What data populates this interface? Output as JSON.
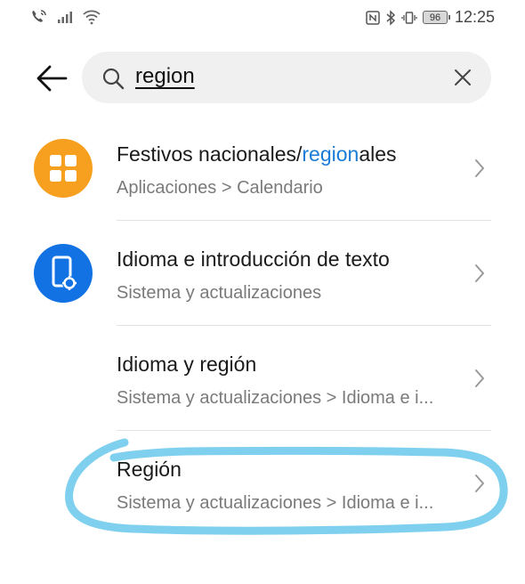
{
  "status_bar": {
    "battery": "96",
    "time": "12:25"
  },
  "search": {
    "query": "region"
  },
  "results": [
    {
      "title_parts": [
        "Festivos nacionales/",
        "region",
        "ales"
      ],
      "subtitle": "Aplicaciones > Calendario",
      "icon": "calendar-app-icon",
      "icon_color": "#f79f1e"
    },
    {
      "title": "Idioma e introducción de texto",
      "subtitle": "Sistema y actualizaciones",
      "icon": "system-settings-icon",
      "icon_color": "#1272e3"
    },
    {
      "title": "Idioma y región",
      "subtitle": "Sistema y actualizaciones > Idioma e i..."
    },
    {
      "title": "Región",
      "subtitle": "Sistema y actualizaciones > Idioma e i..."
    }
  ],
  "colors": {
    "highlight_match": "#1a7bd6",
    "annotation_stroke": "#7fd0ef"
  }
}
